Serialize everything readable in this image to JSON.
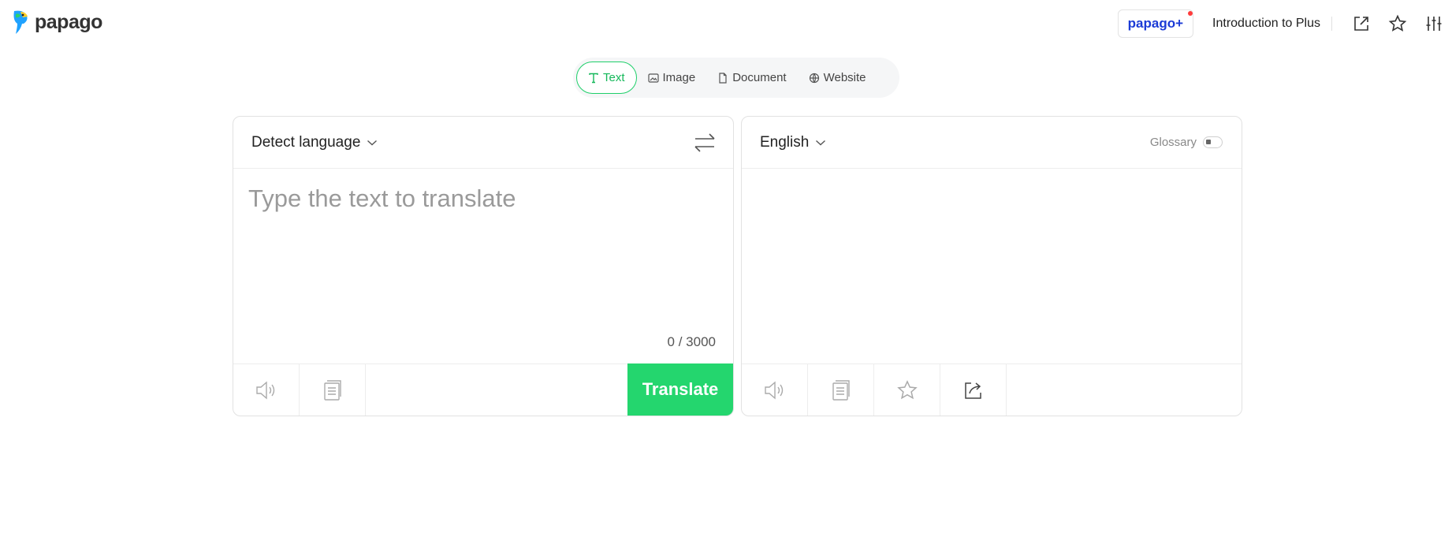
{
  "brand": {
    "logo_text": "papago",
    "accent": "#24d66e"
  },
  "header": {
    "plus_label": "papago+",
    "intro_label": "Introduction to Plus",
    "icons": [
      "open-new-window-icon",
      "star-icon",
      "settings-sliders-icon"
    ]
  },
  "tabs": [
    {
      "label": "Text",
      "icon": "text-icon",
      "active": true
    },
    {
      "label": "Image",
      "icon": "image-icon",
      "active": false
    },
    {
      "label": "Document",
      "icon": "document-icon",
      "active": false
    },
    {
      "label": "Website",
      "icon": "globe-icon",
      "active": false
    }
  ],
  "source": {
    "language": "Detect language",
    "placeholder": "Type the text to translate",
    "value": "",
    "char_count": "0 / 3000",
    "translate_label": "Translate"
  },
  "target": {
    "language": "English",
    "glossary_label": "Glossary",
    "glossary_on": false
  }
}
